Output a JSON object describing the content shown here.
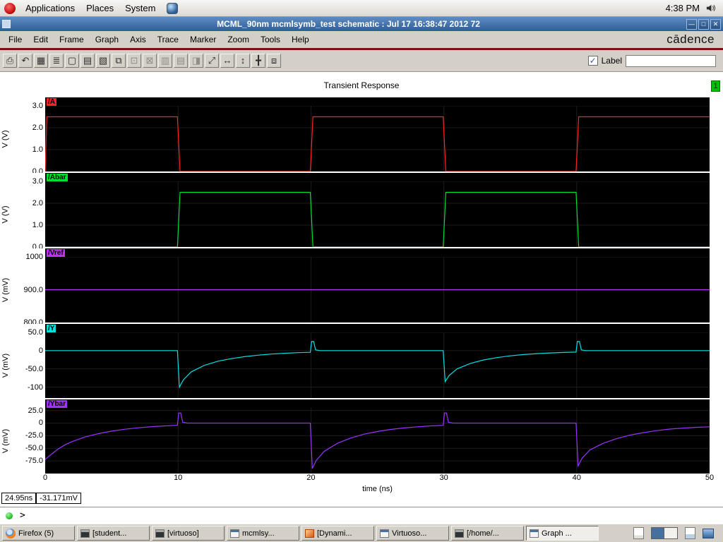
{
  "colors": {
    "titlebar-top": "#5e8cc4",
    "titlebar-bottom": "#2f5d97",
    "maroon": "#7a1014",
    "badge-green": "#00bf00",
    "led-green": "#17b417",
    "active-task": "#efeeea"
  },
  "desktop_panel": {
    "menus": [
      "Applications",
      "Places",
      "System"
    ],
    "clock": "4:38 PM"
  },
  "window": {
    "title": "MCML_90nm mcmlsymb_test schematic : Jul 17 16:38:47 2012 72",
    "brand": "cādence",
    "menus": [
      "File",
      "Edit",
      "Frame",
      "Graph",
      "Axis",
      "Trace",
      "Marker",
      "Zoom",
      "Tools",
      "Help"
    ],
    "buttons": {
      "minimize": "—",
      "maximize": "□",
      "close": "✕"
    }
  },
  "toolbar": {
    "label_text": "Label",
    "label_input_value": "",
    "icons": [
      {
        "name": "print-icon",
        "glyph": "⎙",
        "disabled": false
      },
      {
        "name": "undo-icon",
        "glyph": "↶",
        "disabled": false
      },
      {
        "name": "grid-icon",
        "glyph": "▦",
        "disabled": false
      },
      {
        "name": "legend-icon",
        "glyph": "≣",
        "disabled": false
      },
      {
        "name": "subwindow-icon",
        "glyph": "▢",
        "disabled": false
      },
      {
        "name": "strip-mode-icon",
        "glyph": "▤",
        "disabled": false
      },
      {
        "name": "overlay-mode-icon",
        "glyph": "▧",
        "disabled": false
      },
      {
        "name": "copy-graph-icon",
        "glyph": "⧉",
        "disabled": false
      },
      {
        "name": "snapshot-icon",
        "glyph": "⊡",
        "disabled": true
      },
      {
        "name": "cut-icon",
        "glyph": "⊠",
        "disabled": true
      },
      {
        "name": "vert-marker-icon",
        "glyph": "▥",
        "disabled": true
      },
      {
        "name": "horiz-marker-icon",
        "glyph": "▤",
        "disabled": true
      },
      {
        "name": "point-marker-icon",
        "glyph": "◨",
        "disabled": true
      },
      {
        "name": "zoom-fit-icon",
        "glyph": "⤢",
        "disabled": false
      },
      {
        "name": "zoom-x-icon",
        "glyph": "↔",
        "disabled": false
      },
      {
        "name": "zoom-y-icon",
        "glyph": "↕",
        "disabled": false
      },
      {
        "name": "pan-icon",
        "glyph": "╋",
        "disabled": false
      },
      {
        "name": "fit-window-icon",
        "glyph": "⧈",
        "disabled": false
      }
    ]
  },
  "graph": {
    "title": "Transient Response",
    "page_badge": "1",
    "xlabel": "time (ns)",
    "cursor_x": "24.95ns",
    "cursor_y": "-31.171mV",
    "prompt": ">"
  },
  "chart_data": {
    "type": "line",
    "title": "Transient Response",
    "x_axis": {
      "label": "time (ns)",
      "ticks": [
        0,
        10,
        20,
        30,
        40,
        50
      ],
      "xlim": [
        0,
        50
      ]
    },
    "strips": [
      {
        "name": "/A",
        "color": "#ff2222",
        "ylabel": "V (V)",
        "ylim": [
          0,
          3
        ],
        "yticks": [
          {
            "value": 3,
            "label": "3.0"
          },
          {
            "value": 2,
            "label": "2.0"
          },
          {
            "value": 1,
            "label": "1.0"
          },
          {
            "value": 0,
            "label": "0.0"
          }
        ],
        "points": [
          [
            0,
            0
          ],
          [
            0.12,
            2.5
          ],
          [
            9.95,
            2.5
          ],
          [
            10.15,
            0
          ],
          [
            19.95,
            0
          ],
          [
            20.15,
            2.5
          ],
          [
            29.95,
            2.5
          ],
          [
            30.15,
            0
          ],
          [
            39.95,
            0
          ],
          [
            40.15,
            2.5
          ],
          [
            50,
            2.5
          ]
        ]
      },
      {
        "name": "/Abar",
        "color": "#00dd33",
        "ylabel": "V (V)",
        "ylim": [
          0,
          3
        ],
        "yticks": [
          {
            "value": 3,
            "label": "3.0"
          },
          {
            "value": 2,
            "label": "2.0"
          },
          {
            "value": 1,
            "label": "1.0"
          },
          {
            "value": 0,
            "label": "0.0"
          }
        ],
        "points": [
          [
            0,
            0
          ],
          [
            9.95,
            0
          ],
          [
            10.15,
            2.5
          ],
          [
            19.95,
            2.5
          ],
          [
            20.15,
            0
          ],
          [
            29.95,
            0
          ],
          [
            30.15,
            2.5
          ],
          [
            39.95,
            2.5
          ],
          [
            40.15,
            0
          ],
          [
            50,
            0
          ]
        ]
      },
      {
        "name": "/Vref",
        "color": "#bb33ee",
        "ylabel": "V (mV)",
        "ylim": [
          800,
          1000
        ],
        "yticks": [
          {
            "value": 1000,
            "label": "1000"
          },
          {
            "value": 900,
            "label": "900.0"
          },
          {
            "value": 800,
            "label": "800.0"
          }
        ],
        "points": [
          [
            0,
            900
          ],
          [
            50,
            900
          ]
        ]
      },
      {
        "name": "/Y",
        "color": "#00e0e0",
        "ylabel": "V (mV)",
        "ylim": [
          -130,
          50
        ],
        "yticks": [
          {
            "value": 50,
            "label": "50.0"
          },
          {
            "value": 0,
            "label": "0"
          },
          {
            "value": -50,
            "label": "-50.0"
          },
          {
            "value": -100,
            "label": "-100"
          }
        ],
        "points": [
          [
            0,
            0
          ],
          [
            9.95,
            0
          ],
          [
            10.1,
            -100
          ],
          [
            10.4,
            -80
          ],
          [
            11,
            -58
          ],
          [
            12,
            -40
          ],
          [
            13,
            -29
          ],
          [
            14,
            -22
          ],
          [
            15,
            -16.5
          ],
          [
            16,
            -12.5
          ],
          [
            17,
            -9.5
          ],
          [
            18,
            -7.3
          ],
          [
            19,
            -5.6
          ],
          [
            19.95,
            -4.5
          ],
          [
            20.05,
            25
          ],
          [
            20.2,
            25
          ],
          [
            20.35,
            2
          ],
          [
            20.7,
            0
          ],
          [
            29.95,
            0
          ],
          [
            30.1,
            -85
          ],
          [
            30.4,
            -68
          ],
          [
            31,
            -50
          ],
          [
            32,
            -35
          ],
          [
            33,
            -25.5
          ],
          [
            34,
            -19
          ],
          [
            35,
            -14.3
          ],
          [
            36,
            -10.8
          ],
          [
            37,
            -8.2
          ],
          [
            38,
            -6.3
          ],
          [
            39,
            -4.9
          ],
          [
            39.95,
            -4
          ],
          [
            40.05,
            25
          ],
          [
            40.2,
            25
          ],
          [
            40.35,
            2
          ],
          [
            40.7,
            0
          ],
          [
            50,
            0
          ]
        ]
      },
      {
        "name": "/Ybar",
        "color": "#9933ff",
        "ylabel": "V (mV)",
        "ylim": [
          -100,
          30
        ],
        "yticks": [
          {
            "value": 25,
            "label": "25.0"
          },
          {
            "value": 0,
            "label": "0"
          },
          {
            "value": -25,
            "label": "-25.0"
          },
          {
            "value": -50,
            "label": "-50.0"
          },
          {
            "value": -75,
            "label": "-75.0"
          }
        ],
        "points": [
          [
            0,
            -72
          ],
          [
            0.5,
            -61
          ],
          [
            1,
            -51
          ],
          [
            1.5,
            -43
          ],
          [
            2,
            -37
          ],
          [
            3,
            -27.5
          ],
          [
            4,
            -21
          ],
          [
            5,
            -16
          ],
          [
            6,
            -12.2
          ],
          [
            7,
            -9.4
          ],
          [
            8,
            -7.2
          ],
          [
            9,
            -5.6
          ],
          [
            9.95,
            -4.4
          ],
          [
            10.05,
            20
          ],
          [
            10.2,
            20
          ],
          [
            10.35,
            1.5
          ],
          [
            10.7,
            0
          ],
          [
            19.95,
            0
          ],
          [
            20.1,
            -90
          ],
          [
            20.4,
            -74
          ],
          [
            21,
            -56
          ],
          [
            22,
            -40
          ],
          [
            23,
            -29.5
          ],
          [
            24,
            -22
          ],
          [
            25,
            -16.7
          ],
          [
            26,
            -12.7
          ],
          [
            27,
            -9.7
          ],
          [
            28,
            -7.4
          ],
          [
            29,
            -5.7
          ],
          [
            29.95,
            -4.5
          ],
          [
            30.05,
            20
          ],
          [
            30.2,
            20
          ],
          [
            30.35,
            1.5
          ],
          [
            30.7,
            0
          ],
          [
            39.95,
            0
          ],
          [
            40.1,
            -85
          ],
          [
            40.4,
            -70
          ],
          [
            41,
            -53
          ],
          [
            42,
            -40
          ],
          [
            43,
            -31
          ],
          [
            44,
            -24
          ],
          [
            45,
            -19
          ],
          [
            46,
            -15
          ],
          [
            47,
            -12
          ],
          [
            48,
            -10
          ],
          [
            49,
            -8.5
          ],
          [
            50,
            -7.5
          ]
        ]
      }
    ]
  },
  "taskbar": {
    "buttons": [
      {
        "label": "Firefox (5)",
        "icon": "firefox-icon",
        "active": false
      },
      {
        "label": "[student...",
        "icon": "terminal-icon",
        "active": false
      },
      {
        "label": "[virtuoso]",
        "icon": "terminal-icon",
        "active": false
      },
      {
        "label": "mcmlsy...",
        "icon": "window-icon",
        "active": false
      },
      {
        "label": "[Dynami...",
        "icon": "app-icon",
        "active": false
      },
      {
        "label": "Virtuoso...",
        "icon": "window-icon",
        "active": false
      },
      {
        "label": "[/home/...",
        "icon": "terminal-icon",
        "active": false
      },
      {
        "label": "Graph ...",
        "icon": "window-icon",
        "active": true
      }
    ],
    "tray": [
      "notes-icon",
      "workspace-switcher",
      "document-icon",
      "screen-icon"
    ]
  }
}
